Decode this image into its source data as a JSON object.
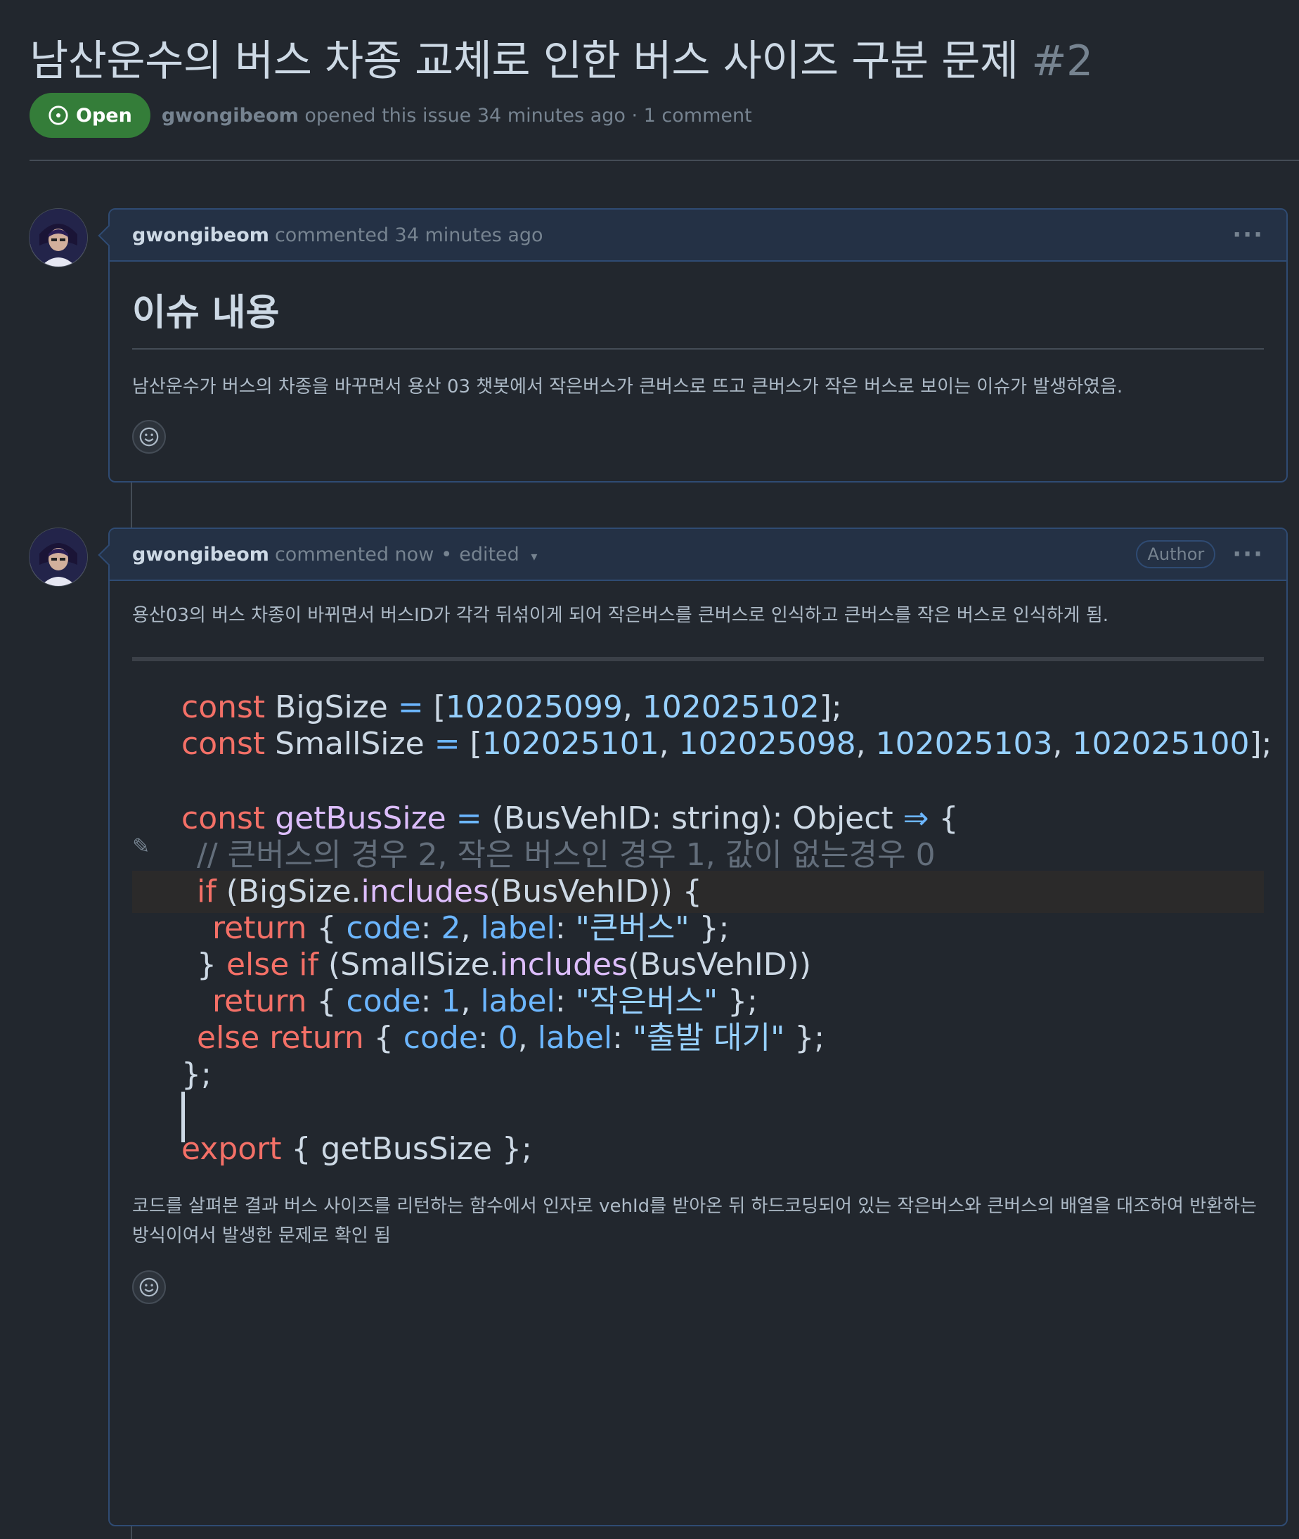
{
  "issue": {
    "title": "남산운수의 버스 차종 교체로 인한 버스 사이즈 구분 문제",
    "number": "#2",
    "state": "Open",
    "author": "gwongibeom",
    "meta_text": "opened this issue 34 minutes ago · 1 comment"
  },
  "comment1": {
    "author": "gwongibeom",
    "action": "commented 34 minutes ago",
    "heading": "이슈 내용",
    "text": "남산운수가 버스의 차종을 바꾸면서 용산 03 챗봇에서 작은버스가 큰버스로 뜨고 큰버스가 작은 버스로 보이는 이슈가 발생하였음."
  },
  "comment2": {
    "author": "gwongibeom",
    "action": "commented now",
    "edited": "edited",
    "author_badge": "Author",
    "intro": "용산03의 버스 차종이 바뀌면서 버스ID가 각각 뒤섞이게 되어 작은버스를 큰버스로 인식하고 큰버스를 작은 버스로 인식하게 됨.",
    "outro": "코드를 살펴본 결과 버스 사이즈를 리턴하는 함수에서 인자로 vehId를 받아온 뒤 하드코딩되어 있는 작은버스와 큰버스의 배열을 대조하여 반환하는 방식이여서 발생한 문제로 확인 됨"
  },
  "code": {
    "big_ids": [
      "102025099",
      "102025102"
    ],
    "small_ids": [
      "102025101",
      "102025098",
      "102025103",
      "102025100"
    ],
    "comment_line": "// 큰버스의 경우 2, 작은 버스인 경우 1, 값이 없는경우 0",
    "label_big": "\"큰버스\"",
    "label_small": "\"작은버스\"",
    "label_wait": "\"출발 대기\""
  },
  "icons": [
    "issue-open-icon",
    "kebab-icon",
    "smiley-icon",
    "caret-down-icon"
  ],
  "colors": {
    "open_green": "#347d39",
    "header_blue": "#243145",
    "border_blue": "#2f4b73",
    "keyword": "#f47067",
    "property": "#6cb6ff"
  }
}
